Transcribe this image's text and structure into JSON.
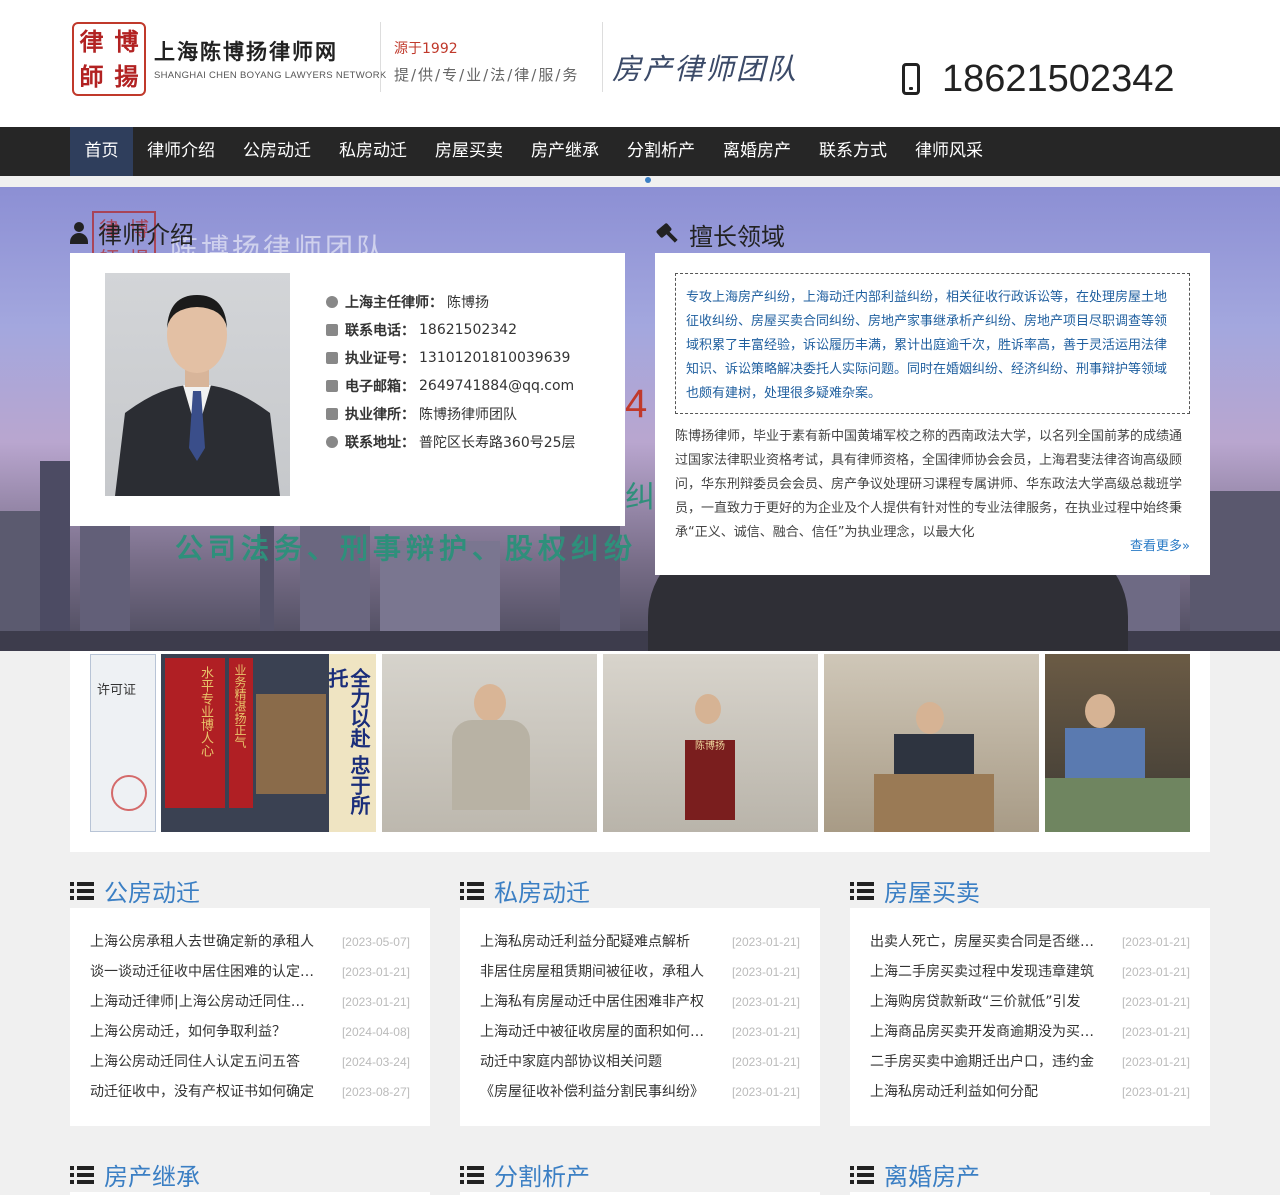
{
  "header": {
    "logo_seal_chars": [
      "律",
      "博",
      "師",
      "揚"
    ],
    "site_name": "上海陈博扬律师网",
    "site_name_en": "SHANGHAI CHEN BOYANG LAWYERS NETWORK",
    "since": "源于1992",
    "slogan": "提/供/专/业/法/律/服/务",
    "team": "房产律师团队",
    "phone": "18621502342"
  },
  "nav": {
    "items": [
      "首页",
      "律师介绍",
      "公房动迁",
      "私房动迁",
      "房屋买卖",
      "房产继承",
      "分割析产",
      "离婚房产",
      "联系方式",
      "律师风采"
    ],
    "active": 0
  },
  "banner": {
    "title": "陈博扬律师团队",
    "seal_chars": [
      "律",
      "博",
      "師",
      "揚"
    ],
    "business": "公司法务、刑事辩护、股权纠纷",
    "partial_number": "4",
    "partial_text": "纠纷"
  },
  "profile": {
    "heading": "律师介绍",
    "rows": [
      {
        "icon": "user-icon",
        "label": "上海主任律师：",
        "value": "陈博扬"
      },
      {
        "icon": "mobile-icon",
        "label": "联系电话：",
        "value": "18621502342"
      },
      {
        "icon": "mobile-icon",
        "label": "执业证号：",
        "value": "13101201810039639"
      },
      {
        "icon": "envelope-icon",
        "label": "电子邮箱：",
        "value": "2649741884@qq.com"
      },
      {
        "icon": "bank-icon",
        "label": "执业律所：",
        "value": "陈博扬律师团队"
      },
      {
        "icon": "map-pin-icon",
        "label": "联系地址：",
        "value": "普陀区长寿路360号25层"
      }
    ]
  },
  "expertise": {
    "heading": "擅长领域",
    "summary": "专攻上海房产纠纷，上海动迁内部利益纠纷，相关征收行政诉讼等，在处理房屋土地征收纠纷、房屋买卖合同纠纷、房地产家事继承析产纠纷、房地产项目尽职调查等领域积累了丰富经验，诉讼履历丰满，累计出庭逾千次，胜诉率高，善于灵活运用法律知识、诉讼策略解决委托人实际问题。同时在婚姻纠纷、经济纠纷、刑事辩护等领域也颇有建树，处理很多疑难杂案。",
    "bio": "陈博扬律师，毕业于素有新中国黄埔军校之称的西南政法大学，以名列全国前茅的成绩通过国家法律职业资格考试，具有律师资格，全国律师协会会员，上海君斐法律咨询高级顾问，华东刑辩委员会会员、房产争议处理研习课程专属讲师、华东政法大学高级总裁班学员，一直致力于更好的为企业及个人提供有针对性的专业法律服务，在执业过程中始终秉承“正义、诚信、融合、信任”为执业理念，以最大化",
    "more": "查看更多»"
  },
  "gallery": {
    "certificate_text": "许可证",
    "banner_left": "水平专业博人心",
    "banner_right": "业务精湛扬正气",
    "scroll_text": "全力以赴 忠于所托",
    "podium_text": "陈博扬"
  },
  "news": [
    {
      "title": "公房动迁",
      "items": [
        {
          "title": "上海公房承租人去世确定新的承租人",
          "date": "[2023-05-07]"
        },
        {
          "title": "谈一谈动迁征收中居住困难的认定问题",
          "date": "[2023-01-21]"
        },
        {
          "title": "上海动迁律师|上海公房动迁同住人认定",
          "date": "[2023-01-21]"
        },
        {
          "title": "上海公房动迁，如何争取利益？",
          "date": "[2024-04-08]"
        },
        {
          "title": "上海公房动迁同住人认定五问五答",
          "date": "[2024-03-24]"
        },
        {
          "title": "动迁征收中，没有产权证书如何确定",
          "date": "[2023-08-27]"
        }
      ]
    },
    {
      "title": "私房动迁",
      "items": [
        {
          "title": "上海私房动迁利益分配疑难点解析",
          "date": "[2023-01-21]"
        },
        {
          "title": "非居住房屋租赁期间被征收，承租人",
          "date": "[2023-01-21]"
        },
        {
          "title": "上海私有房屋动迁中居住困难非产权",
          "date": "[2023-01-21]"
        },
        {
          "title": "上海动迁中被征收房屋的面积如何确定",
          "date": "[2023-01-21]"
        },
        {
          "title": "动迁中家庭内部协议相关问题",
          "date": "[2023-01-21]"
        },
        {
          "title": "《房屋征收补偿利益分割民事纠纷》",
          "date": "[2023-01-21]"
        }
      ]
    },
    {
      "title": "房屋买卖",
      "items": [
        {
          "title": "出卖人死亡，房屋买卖合同是否继续履行",
          "date": "[2023-01-21]"
        },
        {
          "title": "上海二手房买卖过程中发现违章建筑",
          "date": "[2023-01-21]"
        },
        {
          "title": "上海购房贷款新政“三价就低”引发",
          "date": "[2023-01-21]"
        },
        {
          "title": "上海商品房买卖开发商逾期没为买受人",
          "date": "[2023-01-21]"
        },
        {
          "title": "二手房买卖中逾期迁出户口，违约金",
          "date": "[2023-01-21]"
        },
        {
          "title": "上海私房动迁利益如何分配",
          "date": "[2023-01-21]"
        }
      ]
    }
  ],
  "bottom_sections": [
    "房产继承",
    "分割析产",
    "离婚房产"
  ],
  "colors": {
    "accent": "#3b7fc4",
    "nav_bg": "#262626",
    "nav_active": "#2f3e5c",
    "brand_red": "#c0392b"
  }
}
